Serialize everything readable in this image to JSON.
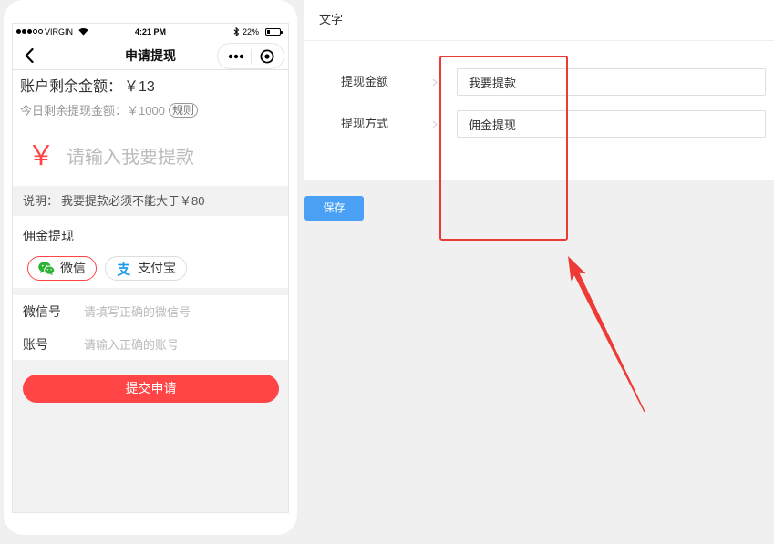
{
  "colors": {
    "accent_red": "#ff4545",
    "wechat_green": "#2fb336",
    "alipay_blue": "#1a9be8",
    "save_blue": "#4aa0f5",
    "annotation_red": "#ee3a35"
  },
  "phone": {
    "status_bar": {
      "signal": {
        "filled": 3,
        "total": 5
      },
      "carrier": "VIRGIN",
      "wifi_icon": "wifi-icon",
      "time": "4:21 PM",
      "bluetooth_icon": "bluetooth-icon",
      "battery_text": "22%",
      "battery_level": 0.22
    },
    "nav": {
      "back_icon": "chevron-left-icon",
      "title": "申请提现",
      "menu_icon": "more-dots-icon",
      "target_icon": "target-circle-icon"
    },
    "balance": {
      "label": "账户剩余金额：",
      "value": "￥13"
    },
    "daily": {
      "label": "今日剩余提现金额：",
      "value": "￥1000",
      "rules_badge": "规则"
    },
    "amount_input": {
      "currency": "￥",
      "placeholder": "请输入我要提款"
    },
    "note": {
      "label": "说明：",
      "text": "我要提款必须不能大于￥80"
    },
    "method_section": {
      "title": "佣金提现",
      "options": [
        {
          "label": "微信",
          "icon": "wechat-icon",
          "selected": true
        },
        {
          "label": "支付宝",
          "icon": "alipay-icon",
          "selected": false
        }
      ]
    },
    "fields": [
      {
        "label": "微信号",
        "placeholder": "请填写正确的微信号"
      },
      {
        "label": "账号",
        "placeholder": "请输入正确的账号"
      }
    ],
    "submit_label": "提交申请"
  },
  "editor": {
    "header_title": "文字",
    "fields": [
      {
        "label": "提现金额",
        "value": "我要提款"
      },
      {
        "label": "提现方式",
        "value": "佣金提现"
      }
    ],
    "save_label": "保存"
  }
}
